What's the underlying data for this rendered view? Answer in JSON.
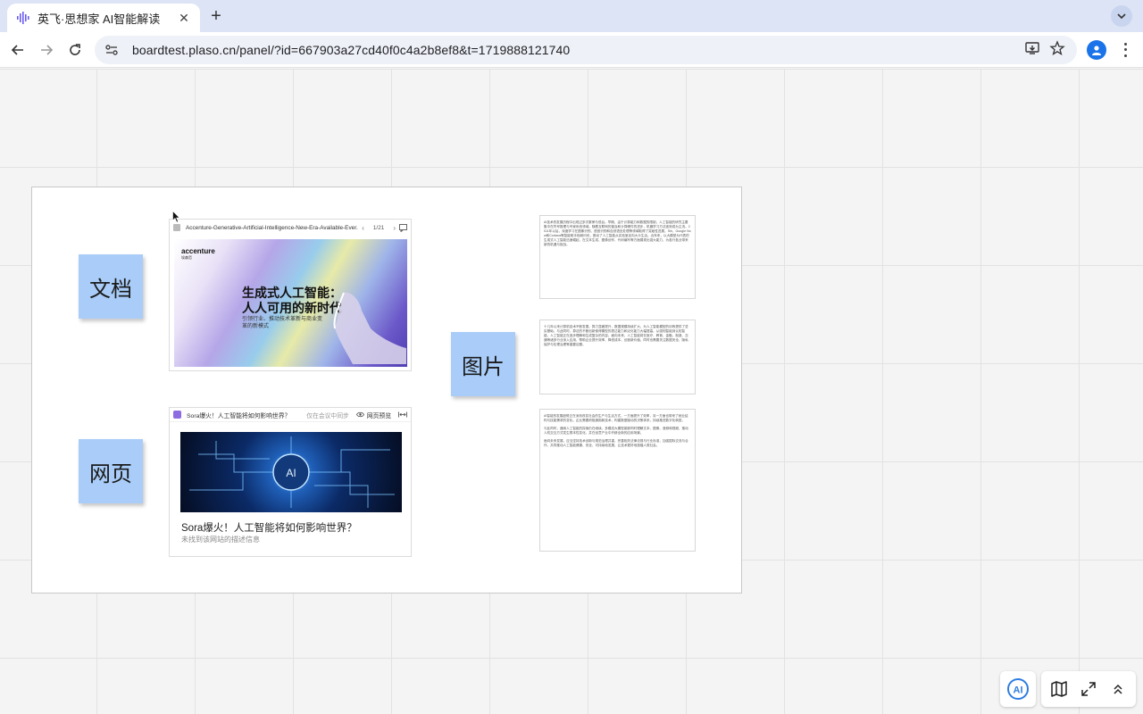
{
  "browser": {
    "tab_title": "英飞·思想家 AI智能解读",
    "url": "boardtest.plaso.cn/panel/?id=667903a27cd40f0c4a2b8ef8&t=1719888121740"
  },
  "stickies": {
    "doc": "文档",
    "image": "图片",
    "web": "网页"
  },
  "doc_card": {
    "filename": "Accenture-Generative-Artificial-Intelligence-New-Era-Available-Ever...",
    "page_indicator": "1/21",
    "slide_logo": "accenture",
    "slide_logo_sub": "埃森哲",
    "slide_title_line1": "生成式人工智能：",
    "slide_title_line2": "人人可用的新时代",
    "slide_subtitle": "引领行业、推动技术革新与商业变革的新模式"
  },
  "web_card": {
    "header_title": "Sora爆火！人工智能将如何影响世界？",
    "only_text": "仅在会议中同步",
    "preview_label": "网页预览",
    "title": "Sora爆火！人工智能将如何影响世界？",
    "description": "未找到该网站的描述信息"
  },
  "pages": [
    [
      "AI技术的发展历程中出现过多次繁荣与低谷。早期，由于计算能力和数据的限制，人工智能的研究主要集中在符号推理与专家系统领域。随着互联网的普及和计算硬件的进步，机器学习方法逐渐成为主流。2011年以后，深度学习在图像识别、语音识别和自然语言处理等领域取得了突破性进展，Siri、Google Now和Cortana等智能助手相继问世，推动了人工智能从实验室走向大众生活。近年来，以大模型为代表的生成式人工智能迅速崛起，在文本生成、图像创作、代码编写等方面展现出强大能力，为各行各业带来新的机遇与挑战。"
    ],
    [
      "十几年以来计算机技术不断发展，算力显著提升，数据规模持续扩大，为人工智能模型的训练提供了坚实基础。与此同时，算法的不断创新使得模型的表达能力和泛化能力大幅提高。从感知智能到认知智能，人工智能正在逐步理解和生成复杂的内容。面向未来，人工智能将在医疗、教育、金融、制造、交通等诸多行业深入应用，帮助企业提升效率、降低成本、创造新价值，同时也需要关注数据安全、隐私保护与伦理治理等重要议题。"
    ],
    [
      "AI智能的发展趋势正在深刻改变社会的生产与生活方式，一方面提升了效率，另一方面也带来了就业结构与技能需求的变化。企业需要积极拥抱新技术，构建数据驱动的决策体系，持续推进数字化转型。",
      "与此同时，通用人工智能的探索仍在继续，多模态大模型能够同时理解文本、图像、音频和视频，推动人机交互方式发生根本性变化，并在创意产业中开辟全新的应用场景。",
      "面向未来发展，应当坚持技术创新与规范治理并重，完善相关法律法规与行业标准，加强国际交流与合作，共同推动人工智能健康、安全、可持续地发展，让技术更好地造福人类社会。"
    ]
  ]
}
